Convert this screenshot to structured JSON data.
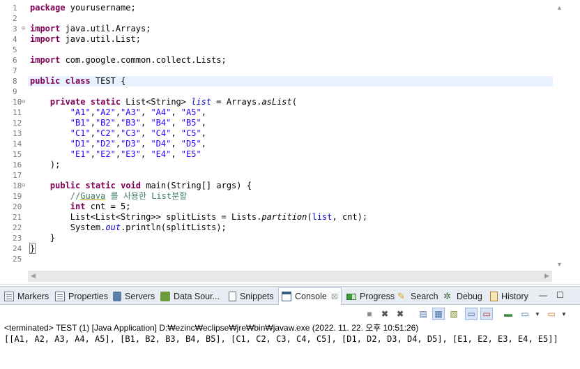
{
  "editor": {
    "lines": [
      {
        "n": "1",
        "fold": ""
      },
      {
        "n": "2",
        "fold": ""
      },
      {
        "n": "3",
        "fold": "⊖"
      },
      {
        "n": "4",
        "fold": ""
      },
      {
        "n": "5",
        "fold": ""
      },
      {
        "n": "6",
        "fold": ""
      },
      {
        "n": "7",
        "fold": ""
      },
      {
        "n": "8",
        "fold": ""
      },
      {
        "n": "9",
        "fold": ""
      },
      {
        "n": "10",
        "fold": "⊖"
      },
      {
        "n": "11",
        "fold": ""
      },
      {
        "n": "12",
        "fold": ""
      },
      {
        "n": "13",
        "fold": ""
      },
      {
        "n": "14",
        "fold": ""
      },
      {
        "n": "15",
        "fold": ""
      },
      {
        "n": "16",
        "fold": ""
      },
      {
        "n": "17",
        "fold": ""
      },
      {
        "n": "18",
        "fold": "⊖"
      },
      {
        "n": "19",
        "fold": ""
      },
      {
        "n": "20",
        "fold": ""
      },
      {
        "n": "21",
        "fold": ""
      },
      {
        "n": "22",
        "fold": ""
      },
      {
        "n": "23",
        "fold": ""
      },
      {
        "n": "24",
        "fold": ""
      },
      {
        "n": "25",
        "fold": ""
      }
    ],
    "code": [
      [
        {
          "t": "k",
          "v": "package"
        },
        {
          "t": "p",
          "v": " yourusername;"
        }
      ],
      [],
      [
        {
          "t": "k",
          "v": "import"
        },
        {
          "t": "p",
          "v": " java.util.Arrays;"
        }
      ],
      [
        {
          "t": "k",
          "v": "import"
        },
        {
          "t": "p",
          "v": " java.util.List;"
        }
      ],
      [],
      [
        {
          "t": "k",
          "v": "import"
        },
        {
          "t": "p",
          "v": " com.google.common.collect.Lists;"
        }
      ],
      [],
      [
        {
          "t": "k",
          "v": "public"
        },
        {
          "t": "p",
          "v": " "
        },
        {
          "t": "k",
          "v": "class"
        },
        {
          "t": "p",
          "v": " TEST {"
        }
      ],
      [],
      [
        {
          "t": "p",
          "v": "    "
        },
        {
          "t": "k",
          "v": "private"
        },
        {
          "t": "p",
          "v": " "
        },
        {
          "t": "k",
          "v": "static"
        },
        {
          "t": "p",
          "v": " List<String> "
        },
        {
          "t": "f",
          "v": "list"
        },
        {
          "t": "p",
          "v": " = Arrays."
        },
        {
          "t": "m",
          "v": "asList"
        },
        {
          "t": "p",
          "v": "("
        }
      ],
      [
        {
          "t": "p",
          "v": "        "
        },
        {
          "t": "s",
          "v": "\"A1\""
        },
        {
          "t": "p",
          "v": ","
        },
        {
          "t": "s",
          "v": "\"A2\""
        },
        {
          "t": "p",
          "v": ","
        },
        {
          "t": "s",
          "v": "\"A3\""
        },
        {
          "t": "p",
          "v": ", "
        },
        {
          "t": "s",
          "v": "\"A4\""
        },
        {
          "t": "p",
          "v": ", "
        },
        {
          "t": "s",
          "v": "\"A5\""
        },
        {
          "t": "p",
          "v": ","
        }
      ],
      [
        {
          "t": "p",
          "v": "        "
        },
        {
          "t": "s",
          "v": "\"B1\""
        },
        {
          "t": "p",
          "v": ","
        },
        {
          "t": "s",
          "v": "\"B2\""
        },
        {
          "t": "p",
          "v": ","
        },
        {
          "t": "s",
          "v": "\"B3\""
        },
        {
          "t": "p",
          "v": ", "
        },
        {
          "t": "s",
          "v": "\"B4\""
        },
        {
          "t": "p",
          "v": ", "
        },
        {
          "t": "s",
          "v": "\"B5\""
        },
        {
          "t": "p",
          "v": ","
        }
      ],
      [
        {
          "t": "p",
          "v": "        "
        },
        {
          "t": "s",
          "v": "\"C1\""
        },
        {
          "t": "p",
          "v": ","
        },
        {
          "t": "s",
          "v": "\"C2\""
        },
        {
          "t": "p",
          "v": ","
        },
        {
          "t": "s",
          "v": "\"C3\""
        },
        {
          "t": "p",
          "v": ", "
        },
        {
          "t": "s",
          "v": "\"C4\""
        },
        {
          "t": "p",
          "v": ", "
        },
        {
          "t": "s",
          "v": "\"C5\""
        },
        {
          "t": "p",
          "v": ","
        }
      ],
      [
        {
          "t": "p",
          "v": "        "
        },
        {
          "t": "s",
          "v": "\"D1\""
        },
        {
          "t": "p",
          "v": ","
        },
        {
          "t": "s",
          "v": "\"D2\""
        },
        {
          "t": "p",
          "v": ","
        },
        {
          "t": "s",
          "v": "\"D3\""
        },
        {
          "t": "p",
          "v": ", "
        },
        {
          "t": "s",
          "v": "\"D4\""
        },
        {
          "t": "p",
          "v": ", "
        },
        {
          "t": "s",
          "v": "\"D5\""
        },
        {
          "t": "p",
          "v": ","
        }
      ],
      [
        {
          "t": "p",
          "v": "        "
        },
        {
          "t": "s",
          "v": "\"E1\""
        },
        {
          "t": "p",
          "v": ","
        },
        {
          "t": "s",
          "v": "\"E2\""
        },
        {
          "t": "p",
          "v": ","
        },
        {
          "t": "s",
          "v": "\"E3\""
        },
        {
          "t": "p",
          "v": ", "
        },
        {
          "t": "s",
          "v": "\"E4\""
        },
        {
          "t": "p",
          "v": ", "
        },
        {
          "t": "s",
          "v": "\"E5\""
        }
      ],
      [
        {
          "t": "p",
          "v": "    );"
        }
      ],
      [],
      [
        {
          "t": "p",
          "v": "    "
        },
        {
          "t": "k",
          "v": "public"
        },
        {
          "t": "p",
          "v": " "
        },
        {
          "t": "k",
          "v": "static"
        },
        {
          "t": "p",
          "v": " "
        },
        {
          "t": "k",
          "v": "void"
        },
        {
          "t": "p",
          "v": " main(String[] args) {"
        }
      ],
      [
        {
          "t": "p",
          "v": "        "
        },
        {
          "t": "c",
          "v": "//"
        },
        {
          "t": "cu",
          "v": "Guava"
        },
        {
          "t": "c",
          "v": " 를 사용한 List분할"
        }
      ],
      [
        {
          "t": "p",
          "v": "        "
        },
        {
          "t": "k",
          "v": "int"
        },
        {
          "t": "p",
          "v": " cnt = 5;"
        }
      ],
      [
        {
          "t": "p",
          "v": "        List<List<String>> splitLists = Lists."
        },
        {
          "t": "m",
          "v": "partition"
        },
        {
          "t": "p",
          "v": "("
        },
        {
          "t": "fp",
          "v": "list"
        },
        {
          "t": "p",
          "v": ", cnt);"
        }
      ],
      [
        {
          "t": "p",
          "v": "        System."
        },
        {
          "t": "f",
          "v": "out"
        },
        {
          "t": "p",
          "v": ".println(splitLists);"
        }
      ],
      [
        {
          "t": "p",
          "v": "    }"
        }
      ],
      [
        {
          "t": "b",
          "v": "}"
        }
      ],
      []
    ],
    "current_line": 8
  },
  "panel": {
    "tabs": [
      {
        "id": "markers",
        "label": "Markers",
        "icon": "markers-icon"
      },
      {
        "id": "properties",
        "label": "Properties",
        "icon": "properties-icon"
      },
      {
        "id": "servers",
        "label": "Servers",
        "icon": "servers-icon"
      },
      {
        "id": "datasource",
        "label": "Data Sour...",
        "icon": "data-source-icon"
      },
      {
        "id": "snippets",
        "label": "Snippets",
        "icon": "snippets-icon"
      },
      {
        "id": "console",
        "label": "Console",
        "icon": "console-icon",
        "close": "☒"
      },
      {
        "id": "progress",
        "label": "Progress",
        "icon": "progress-icon"
      },
      {
        "id": "search",
        "label": "Search",
        "icon": "search-icon"
      },
      {
        "id": "debug",
        "label": "Debug",
        "icon": "debug-icon"
      },
      {
        "id": "history",
        "label": "History",
        "icon": "history-icon"
      }
    ],
    "window_minimize": "—",
    "window_maximize": "☐",
    "status": "<terminated> TEST (1) [Java Application] D:₩ezinc₩eclipse₩jre₩bin₩javaw.exe  (2022. 11. 22. 오후 10:51:26)",
    "output": "[[A1, A2, A3, A4, A5], [B1, B2, B3, B4, B5], [C1, C2, C3, C4, C5], [D1, D2, D3, D4, D5], [E1, E2, E3, E4, E5]]"
  },
  "colors": {
    "keyword": "#7f0055",
    "string": "#2a00ff",
    "field": "#0000c0",
    "comment": "#3f7f5f",
    "current_line": "#e8f2fe",
    "tabbar": "#e8edf4"
  }
}
